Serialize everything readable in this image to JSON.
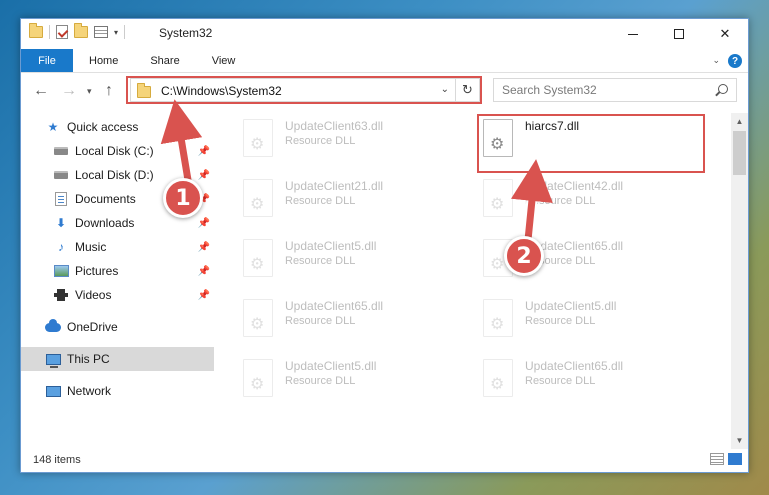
{
  "window": {
    "title": "System32",
    "ribbon_tabs": [
      {
        "label": "File"
      },
      {
        "label": "Home"
      },
      {
        "label": "Share"
      },
      {
        "label": "View"
      }
    ]
  },
  "address_bar": {
    "path": "C:\\Windows\\System32"
  },
  "search": {
    "placeholder": "Search System32"
  },
  "sidebar": {
    "items": [
      {
        "label": "Quick access",
        "icon": "star-icon",
        "pinned": false
      },
      {
        "label": "Local Disk (C:)",
        "icon": "drive-icon",
        "pinned": true
      },
      {
        "label": "Local Disk (D:)",
        "icon": "drive-icon",
        "pinned": true
      },
      {
        "label": "Documents",
        "icon": "documents-icon",
        "pinned": true
      },
      {
        "label": "Downloads",
        "icon": "downloads-icon",
        "pinned": true
      },
      {
        "label": "Music",
        "icon": "music-icon",
        "pinned": true
      },
      {
        "label": "Pictures",
        "icon": "pictures-icon",
        "pinned": true
      },
      {
        "label": "Videos",
        "icon": "videos-icon",
        "pinned": true
      },
      {
        "label": "OneDrive",
        "icon": "onedrive-icon",
        "pinned": false
      },
      {
        "label": "This PC",
        "icon": "this-pc-icon",
        "pinned": false,
        "selected": true
      },
      {
        "label": "Network",
        "icon": "network-icon",
        "pinned": false
      }
    ]
  },
  "files": {
    "left_column": [
      {
        "name": "UpdateClient63.dll",
        "type": "Resource DLL"
      },
      {
        "name": "UpdateClient21.dll",
        "type": "Resource DLL"
      },
      {
        "name": "UpdateClient5.dll",
        "type": "Resource DLL"
      },
      {
        "name": "UpdateClient65.dll",
        "type": "Resource DLL"
      },
      {
        "name": "UpdateClient5.dll",
        "type": "Resource DLL"
      }
    ],
    "right_column": [
      {
        "name": "hiarcs7.dll",
        "type": ""
      },
      {
        "name": "UpdateClient42.dll",
        "type": "Resource DLL"
      },
      {
        "name": "UpdateClient65.dll",
        "type": "Resource DLL"
      },
      {
        "name": "UpdateClient5.dll",
        "type": "Resource DLL"
      },
      {
        "name": "UpdateClient65.dll",
        "type": "Resource DLL"
      }
    ]
  },
  "status": {
    "item_count": "148 items"
  },
  "annotations": {
    "step1": "1",
    "step2": "2",
    "color": "#d9534f"
  }
}
